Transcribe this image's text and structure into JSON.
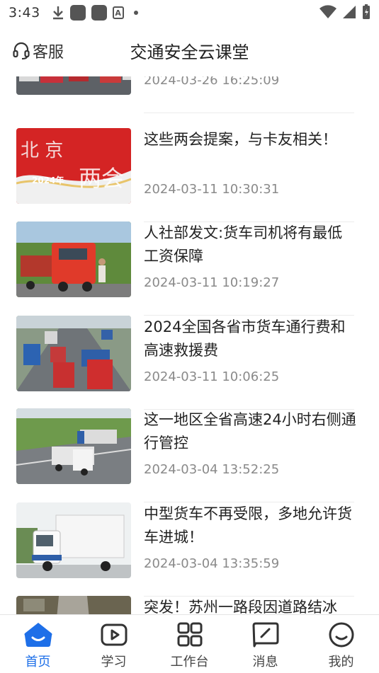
{
  "status_bar": {
    "time": "3:43",
    "small_icon_letter": "A"
  },
  "header": {
    "service_label": "客服",
    "title": "交通安全云课堂"
  },
  "articles": [
    {
      "title": "",
      "date": "2024-03-26 16:25:09",
      "image": "trucks-parked"
    },
    {
      "title": "这些两会提案，与卡友相关！",
      "date": "2024-03-11 10:30:31",
      "image": "two-sessions-banner",
      "banner_text": "北京 2024年 两会"
    },
    {
      "title": "人社部发文:货车司机将有最低工资保障",
      "date": "2024-03-11 10:19:27",
      "image": "red-truck-driver"
    },
    {
      "title": "2024全国各省市货车通行费和高速救援费",
      "date": "2024-03-11 10:06:25",
      "image": "highway-traffic"
    },
    {
      "title": "这一地区全省高速24小时右侧通行管控",
      "date": "2024-03-04 13:52:25",
      "image": "highway-trucks"
    },
    {
      "title": "中型货车不再受限，多地允许货车进城！",
      "date": "2024-03-04 13:35:59",
      "image": "white-box-truck"
    },
    {
      "title": "突发！苏州一路段因道路结冰",
      "date": "",
      "image": "icy-road"
    }
  ],
  "bottom_nav": [
    {
      "label": "首页",
      "icon": "home-icon",
      "active": true
    },
    {
      "label": "学习",
      "icon": "play-icon",
      "active": false
    },
    {
      "label": "工作台",
      "icon": "grid-icon",
      "active": false
    },
    {
      "label": "消息",
      "icon": "message-icon",
      "active": false
    },
    {
      "label": "我的",
      "icon": "smile-icon",
      "active": false
    }
  ],
  "colors": {
    "accent": "#1e6fe8",
    "date_text": "#8a8a8a"
  }
}
